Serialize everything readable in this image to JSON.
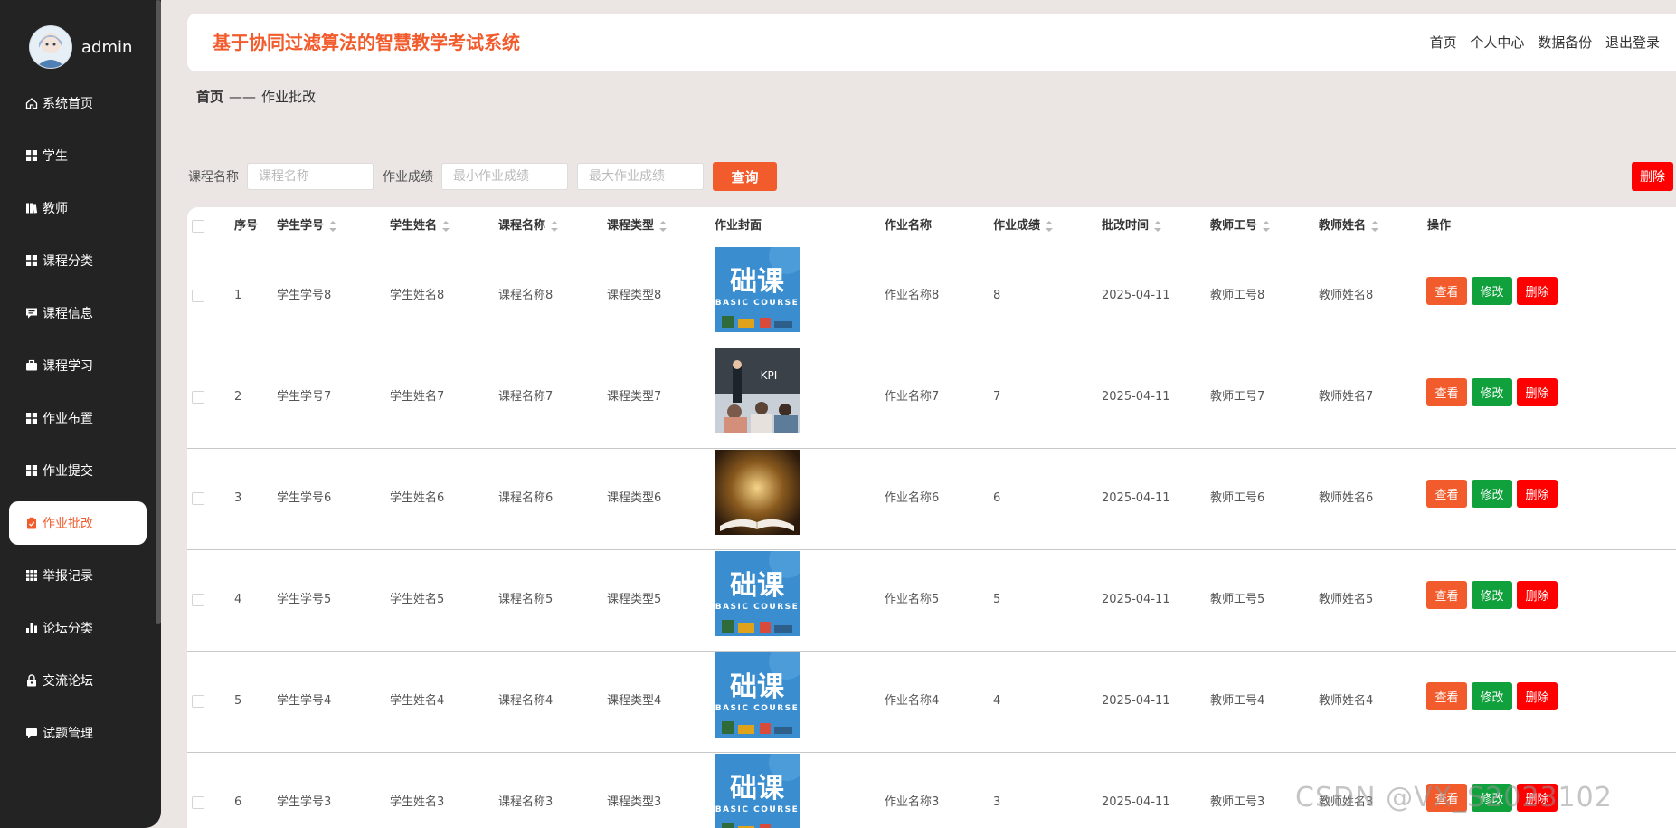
{
  "user": {
    "name": "admin"
  },
  "menu": [
    {
      "label": "系统首页",
      "icon": "home-icon"
    },
    {
      "label": "学生",
      "icon": "grid-icon"
    },
    {
      "label": "教师",
      "icon": "book-icon"
    },
    {
      "label": "课程分类",
      "icon": "grid-icon"
    },
    {
      "label": "课程信息",
      "icon": "chat-icon"
    },
    {
      "label": "课程学习",
      "icon": "briefcase-icon"
    },
    {
      "label": "作业布置",
      "icon": "grid-icon"
    },
    {
      "label": "作业提交",
      "icon": "grid-icon"
    },
    {
      "label": "作业批改",
      "icon": "clipboard-icon",
      "active": true
    },
    {
      "label": "举报记录",
      "icon": "apps-icon"
    },
    {
      "label": "论坛分类",
      "icon": "bar-chart-icon"
    },
    {
      "label": "交流论坛",
      "icon": "lock-icon"
    },
    {
      "label": "试题管理",
      "icon": "message-icon"
    }
  ],
  "header": {
    "title": "基于协同过滤算法的智慧教学考试系统",
    "nav": [
      "首页",
      "个人中心",
      "数据备份",
      "退出登录"
    ]
  },
  "breadcrumb": {
    "home": "首页",
    "separator": "——",
    "current": "作业批改"
  },
  "search": {
    "course_label": "课程名称",
    "course_placeholder": "课程名称",
    "score_label": "作业成绩",
    "min_placeholder": "最小作业成绩",
    "max_placeholder": "最大作业成绩",
    "query_button": "查询",
    "delete_button": "删除"
  },
  "table": {
    "columns": [
      "序号",
      "学生学号",
      "学生姓名",
      "课程名称",
      "课程类型",
      "作业封面",
      "作业名称",
      "作业成绩",
      "批改时间",
      "教师工号",
      "教师姓名",
      "操作"
    ],
    "sortable": [
      false,
      true,
      true,
      true,
      true,
      false,
      false,
      true,
      true,
      true,
      true,
      false
    ],
    "rows": [
      {
        "idx": "1",
        "student_no": "学生学号8",
        "student_name": "学生姓名8",
        "course_name": "课程名称8",
        "course_type": "课程类型8",
        "cover": "basic-course",
        "hw_name": "作业名称8",
        "score": "8",
        "time": "2025-04-11",
        "teacher_no": "教师工号8",
        "teacher_name": "教师姓名8"
      },
      {
        "idx": "2",
        "student_no": "学生学号7",
        "student_name": "学生姓名7",
        "course_name": "课程名称7",
        "course_type": "课程类型7",
        "cover": "classroom-kpi",
        "cover_caption": "KPI",
        "hw_name": "作业名称7",
        "score": "7",
        "time": "2025-04-11",
        "teacher_no": "教师工号7",
        "teacher_name": "教师姓名7"
      },
      {
        "idx": "3",
        "student_no": "学生学号6",
        "student_name": "学生姓名6",
        "course_name": "课程名称6",
        "course_type": "课程类型6",
        "cover": "open-book",
        "hw_name": "作业名称6",
        "score": "6",
        "time": "2025-04-11",
        "teacher_no": "教师工号6",
        "teacher_name": "教师姓名6"
      },
      {
        "idx": "4",
        "student_no": "学生学号5",
        "student_name": "学生姓名5",
        "course_name": "课程名称5",
        "course_type": "课程类型5",
        "cover": "basic-course",
        "hw_name": "作业名称5",
        "score": "5",
        "time": "2025-04-11",
        "teacher_no": "教师工号5",
        "teacher_name": "教师姓名5"
      },
      {
        "idx": "5",
        "student_no": "学生学号4",
        "student_name": "学生姓名4",
        "course_name": "课程名称4",
        "course_type": "课程类型4",
        "cover": "basic-course",
        "hw_name": "作业名称4",
        "score": "4",
        "time": "2025-04-11",
        "teacher_no": "教师工号4",
        "teacher_name": "教师姓名4"
      },
      {
        "idx": "6",
        "student_no": "学生学号3",
        "student_name": "学生姓名3",
        "course_name": "课程名称3",
        "course_type": "课程类型3",
        "cover": "basic-course",
        "hw_name": "作业名称3",
        "score": "3",
        "time": "2025-04-11",
        "teacher_no": "教师工号3",
        "teacher_name": "教师姓名3"
      }
    ],
    "actions": {
      "view": "查看",
      "edit": "修改",
      "delete": "删除"
    },
    "cover_text": {
      "main": "础课",
      "sub": "BASIC COURSE"
    }
  },
  "watermark": "CSDN @VX_S2023102",
  "colors": {
    "accent": "#f25b2c",
    "edit": "#10a03c",
    "danger": "#ff0000",
    "sidebar": "#232323"
  }
}
